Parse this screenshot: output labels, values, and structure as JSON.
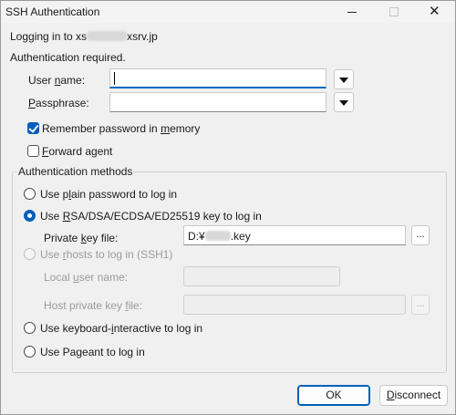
{
  "window": {
    "title": "SSH Authentication"
  },
  "login": {
    "prefix": "Logging in to xs",
    "suffix": "xsrv.jp"
  },
  "auth_required": "Authentication required.",
  "user_name": {
    "label_pre": "",
    "label_u": "U",
    "label_mid": "ser ",
    "label_u2": "n",
    "label_post": "ame:",
    "value": ""
  },
  "passphrase": {
    "label_u": "P",
    "label_post": "assphrase:",
    "value": ""
  },
  "remember": {
    "pre": "Remember password in ",
    "u": "m",
    "post": "emory",
    "checked": true
  },
  "forward": {
    "u": "F",
    "post": "orward agent",
    "checked": false
  },
  "group": {
    "title": "Authentication methods"
  },
  "methods": {
    "plain": {
      "pre": "Use p",
      "u": "l",
      "post": "ain password to log in"
    },
    "rsa": {
      "pre": "Use ",
      "u": "R",
      "post": "SA/DSA/ECDSA/ED25519 key to log in"
    },
    "rhosts": {
      "pre": "Use ",
      "u": "r",
      "post": "hosts to log in (SSH1)"
    },
    "kbd": {
      "pre": "Use keyboard-",
      "u": "i",
      "post": "nteractive to log in"
    },
    "pageant": {
      "pre": "Use Pa",
      "u": "g",
      "post": "eant to log in"
    }
  },
  "private_key": {
    "pre": "Private ",
    "u": "k",
    "post": "ey file:",
    "value_pre": "D:¥",
    "value_post": ".key"
  },
  "local_user": {
    "pre": "Local ",
    "u": "u",
    "post": "ser name:"
  },
  "host_key": {
    "pre": "Host private key ",
    "u": "f",
    "post": "ile:"
  },
  "buttons": {
    "browse": "...",
    "ok": "OK",
    "disconnect_u": "D",
    "disconnect_post": "isconnect"
  },
  "colors": {
    "accent": "#005fb8",
    "background": "#f0f0f0"
  }
}
